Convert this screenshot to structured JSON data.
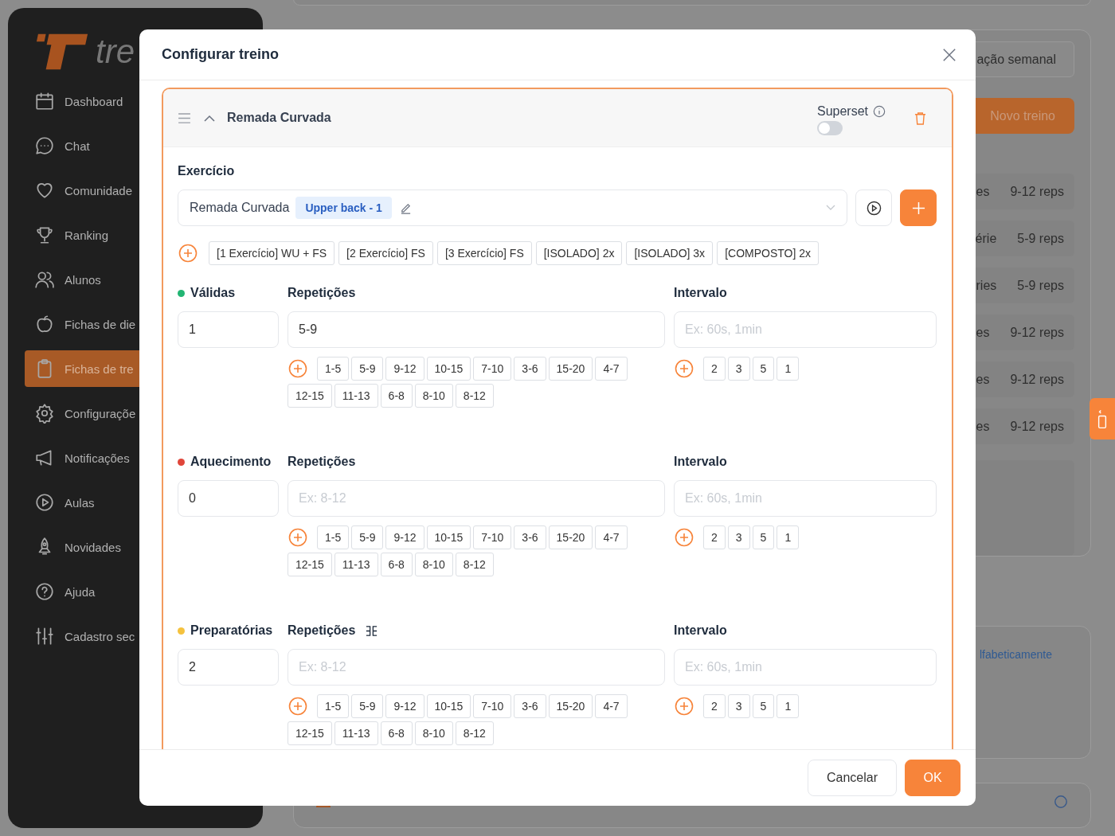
{
  "sidebar": {
    "logo_text": "tre",
    "items": [
      {
        "label": "Dashboard",
        "selected": false
      },
      {
        "label": "Chat",
        "selected": false
      },
      {
        "label": "Comunidade",
        "selected": false
      },
      {
        "label": "Ranking",
        "selected": false
      },
      {
        "label": "Alunos",
        "selected": false
      },
      {
        "label": "Fichas de die",
        "selected": false
      },
      {
        "label": "Fichas de tre",
        "selected": true
      },
      {
        "label": "Configuraçõe",
        "selected": false
      },
      {
        "label": "Notificações",
        "selected": false
      },
      {
        "label": "Aulas",
        "selected": false
      },
      {
        "label": "Novidades",
        "selected": false
      },
      {
        "label": "Ajuda",
        "selected": false
      },
      {
        "label": "Cadastro sec",
        "selected": false
      }
    ]
  },
  "background": {
    "week_button": "ação semanal",
    "new_button": "Novo treino",
    "rows": [
      {
        "fragment": "es",
        "reps": "9-12 reps"
      },
      {
        "fragment": "érie",
        "reps": "5-9 reps"
      },
      {
        "fragment": "ries",
        "reps": "5-9 reps"
      },
      {
        "fragment": "es",
        "reps": "9-12 reps"
      },
      {
        "fragment": "es",
        "reps": "9-12 reps"
      },
      {
        "fragment": "es",
        "reps": "9-12 reps"
      }
    ],
    "sort_link": "lfabeticamente"
  },
  "modal": {
    "title": "Configurar treino",
    "exercise": {
      "name": "Remada Curvada",
      "expanded": true,
      "superset_label": "Superset",
      "superset": false,
      "field_label": "Exercício",
      "value": "Remada Curvada",
      "tag": "Upper back - 1",
      "presets": [
        "[1 Exercício] WU + FS",
        "[2 Exercício] FS",
        "[3 Exercício] FS",
        "[ISOLADO] 2x",
        "[ISOLADO] 3x",
        "[COMPOSTO] 2x"
      ]
    },
    "series": [
      {
        "label": "Válidas",
        "color": "#22b573",
        "count": "1",
        "reps_label": "Repetições",
        "reps_value": "5-9",
        "interval_label": "Intervalo",
        "interval_placeholder": "Ex: 60s, 1min",
        "rep_chips": [
          "1-5",
          "5-9",
          "9-12",
          "10-15",
          "7-10",
          "3-6",
          "15-20",
          "4-7",
          "12-15",
          "11-13",
          "6-8",
          "8-10",
          "8-12"
        ],
        "interval_chips": [
          "2",
          "3",
          "5",
          "1"
        ]
      },
      {
        "label": "Aquecimento",
        "color": "#e0463a",
        "count": "0",
        "reps_label": "Repetições",
        "reps_placeholder": "Ex: 8-12",
        "interval_label": "Intervalo",
        "interval_placeholder": "Ex: 60s, 1min",
        "rep_chips": [
          "1-5",
          "5-9",
          "9-12",
          "10-15",
          "7-10",
          "3-6",
          "15-20",
          "4-7",
          "12-15",
          "11-13",
          "6-8",
          "8-10",
          "8-12"
        ],
        "interval_chips": [
          "2",
          "3",
          "5",
          "1"
        ]
      },
      {
        "label": "Preparatórias",
        "color": "#f5c23e",
        "count": "2",
        "reps_label": "Repetições",
        "reps_icon": true,
        "reps_placeholder": "Ex: 8-12",
        "interval_label": "Intervalo",
        "interval_placeholder": "Ex: 60s, 1min",
        "rep_chips": [
          "1-5",
          "5-9",
          "9-12",
          "10-15",
          "7-10",
          "3-6",
          "15-20",
          "4-7",
          "12-15",
          "11-13",
          "6-8",
          "8-10",
          "8-12"
        ],
        "interval_chips": [
          "2",
          "3",
          "5",
          "1"
        ]
      }
    ],
    "buttons": {
      "cancel": "Cancelar",
      "ok": "OK"
    }
  }
}
